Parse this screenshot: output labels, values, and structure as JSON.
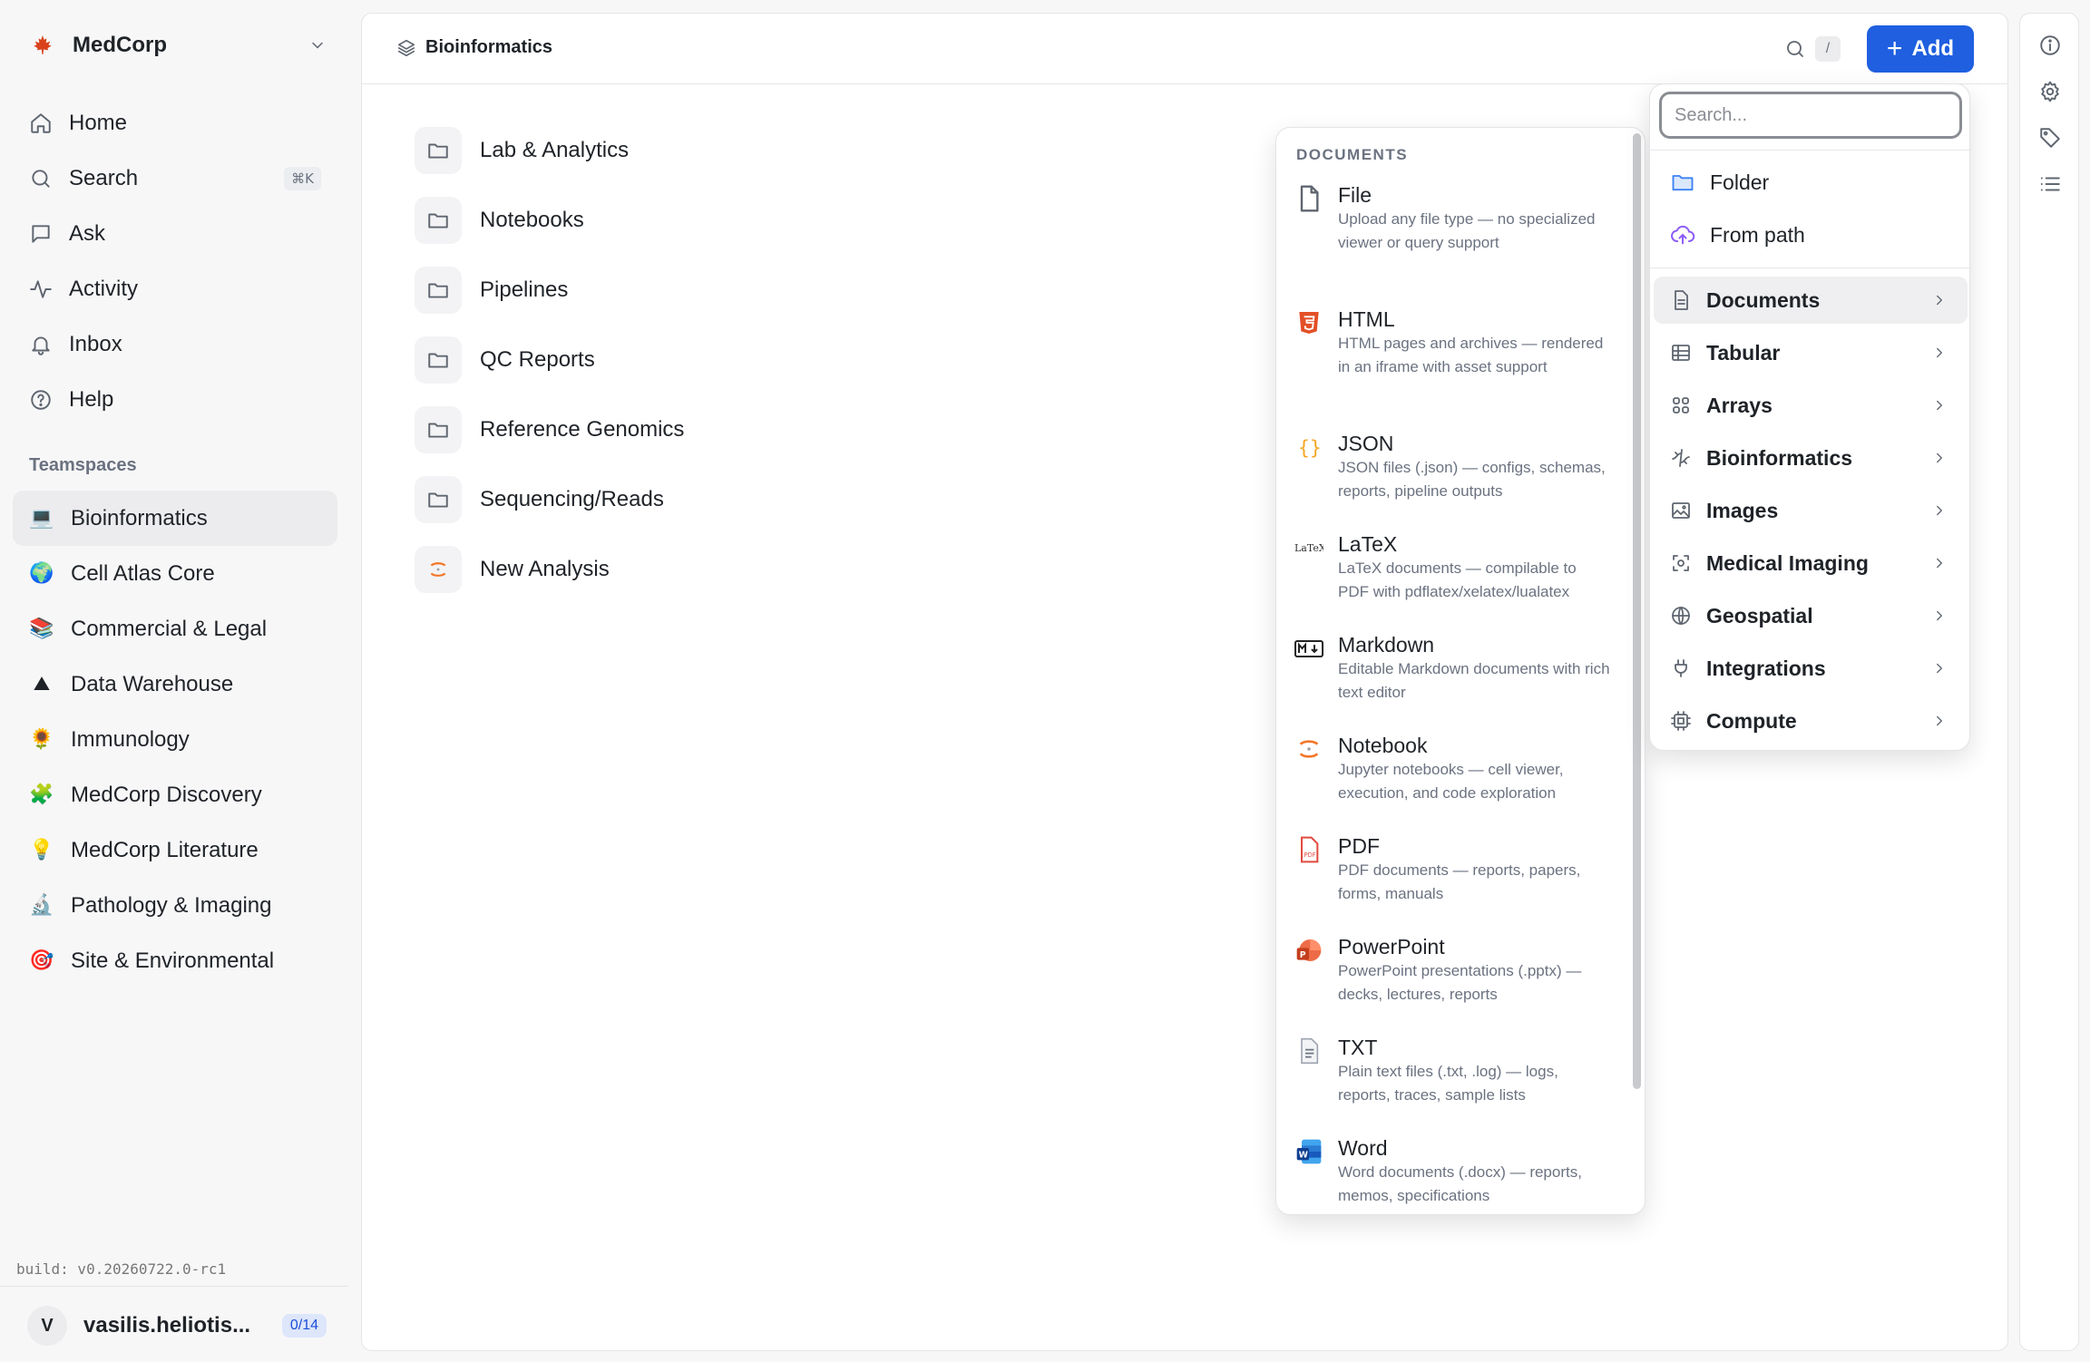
{
  "org": {
    "name": "MedCorp"
  },
  "nav": {
    "home": "Home",
    "search": "Search",
    "search_shortcut": "⌘K",
    "ask": "Ask",
    "activity": "Activity",
    "inbox": "Inbox",
    "help": "Help"
  },
  "teamspaces": {
    "heading": "Teamspaces",
    "items": [
      {
        "emoji": "💻",
        "label": "Bioinformatics"
      },
      {
        "emoji": "🌍",
        "label": "Cell Atlas Core"
      },
      {
        "emoji": "📚",
        "label": "Commercial & Legal"
      },
      {
        "emoji": "⛰",
        "label": "Data Warehouse"
      },
      {
        "emoji": "🌻",
        "label": "Immunology"
      },
      {
        "emoji": "🧩",
        "label": "MedCorp Discovery"
      },
      {
        "emoji": "💡",
        "label": "MedCorp Literature"
      },
      {
        "emoji": "🔬",
        "label": "Pathology & Imaging"
      },
      {
        "emoji": "🎯",
        "label": "Site & Environmental"
      }
    ]
  },
  "build": "build: v0.20260722.0-rc1",
  "user": {
    "initial": "V",
    "name": "vasilis.heliotis...",
    "badge": "0/14"
  },
  "header": {
    "breadcrumb": "Bioinformatics",
    "shortcut": "/",
    "add_label": "Add"
  },
  "folders": [
    {
      "label": "Lab & Analytics",
      "icon": "folder-icon"
    },
    {
      "label": "Notebooks",
      "icon": "folder-icon"
    },
    {
      "label": "Pipelines",
      "icon": "folder-icon"
    },
    {
      "label": "QC Reports",
      "icon": "folder-icon"
    },
    {
      "label": "Reference Genomics",
      "icon": "folder-icon"
    },
    {
      "label": "Sequencing/Reads",
      "icon": "folder-icon"
    },
    {
      "label": "New Analysis",
      "icon": "jupyter-icon"
    }
  ],
  "add_menu": {
    "search_placeholder": "Search...",
    "folder": "Folder",
    "from_path": "From path",
    "categories": [
      "Documents",
      "Tabular",
      "Arrays",
      "Bioinformatics",
      "Images",
      "Medical Imaging",
      "Geospatial",
      "Integrations",
      "Compute"
    ]
  },
  "documents_menu": {
    "heading": "DOCUMENTS",
    "items": [
      {
        "title": "File",
        "desc": "Upload any file type — no specialized viewer or query support"
      },
      {
        "title": "HTML",
        "desc": "HTML pages and archives — rendered in an iframe with asset support"
      },
      {
        "title": "JSON",
        "desc": "JSON files (.json) — configs, schemas, reports, pipeline outputs"
      },
      {
        "title": "LaTeX",
        "desc": "LaTeX documents — compilable to PDF with pdflatex/xelatex/lualatex"
      },
      {
        "title": "Markdown",
        "desc": "Editable Markdown documents with rich text editor"
      },
      {
        "title": "Notebook",
        "desc": "Jupyter notebooks — cell viewer, execution, and code exploration"
      },
      {
        "title": "PDF",
        "desc": "PDF documents — reports, papers, forms, manuals"
      },
      {
        "title": "PowerPoint",
        "desc": "PowerPoint presentations (.pptx) — decks, lectures, reports"
      },
      {
        "title": "TXT",
        "desc": "Plain text files (.txt, .log) — logs, reports, traces, sample lists"
      },
      {
        "title": "Word",
        "desc": "Word documents (.docx) — reports, memos, specifications"
      }
    ]
  },
  "colors": {
    "accent": "#1f5fe0",
    "brand": "#d9421b"
  }
}
